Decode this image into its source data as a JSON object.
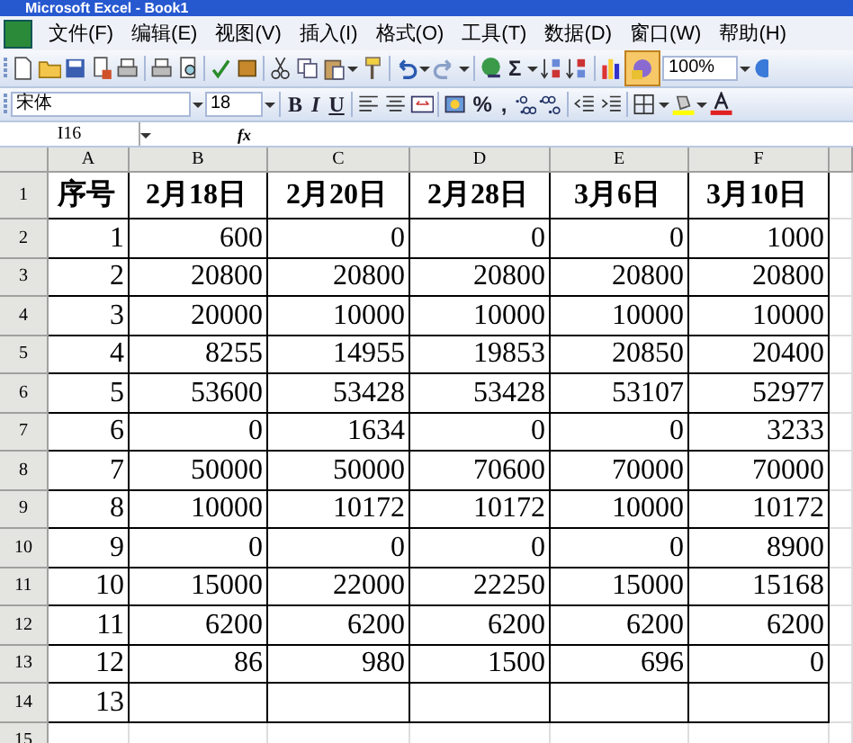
{
  "window": {
    "title": "Microsoft Excel - Book1"
  },
  "menu": [
    "文件(F)",
    "编辑(E)",
    "视图(V)",
    "插入(I)",
    "格式(O)",
    "工具(T)",
    "数据(D)",
    "窗口(W)",
    "帮助(H)"
  ],
  "standard_toolbar": {
    "sum": "Σ",
    "zoom": "100%"
  },
  "formatting_toolbar": {
    "font": "宋体",
    "size": "18",
    "bold": "B",
    "italic": "I",
    "underline": "U",
    "percent": "%",
    "comma": ","
  },
  "formula_bar": {
    "name_box": "I16",
    "fx": "fx"
  },
  "columns": [
    "A",
    "B",
    "C",
    "D",
    "E",
    "F"
  ],
  "rows": [
    {
      "number": "1",
      "cells": [
        "序号",
        "2月18日",
        "2月20日",
        "2月28日",
        "3月6日",
        "3月10日"
      ],
      "kind": "header"
    },
    {
      "number": "2",
      "cells": [
        "1",
        "600",
        "0",
        "0",
        "0",
        "1000"
      ],
      "kind": "data"
    },
    {
      "number": "3",
      "cells": [
        "2",
        "20800",
        "20800",
        "20800",
        "20800",
        "20800"
      ],
      "kind": "data"
    },
    {
      "number": "4",
      "cells": [
        "3",
        "20000",
        "10000",
        "10000",
        "10000",
        "10000"
      ],
      "kind": "data"
    },
    {
      "number": "5",
      "cells": [
        "4",
        "8255",
        "14955",
        "19853",
        "20850",
        "20400"
      ],
      "kind": "data"
    },
    {
      "number": "6",
      "cells": [
        "5",
        "53600",
        "53428",
        "53428",
        "53107",
        "52977"
      ],
      "kind": "data"
    },
    {
      "number": "7",
      "cells": [
        "6",
        "0",
        "1634",
        "0",
        "0",
        "3233"
      ],
      "kind": "data"
    },
    {
      "number": "8",
      "cells": [
        "7",
        "50000",
        "50000",
        "70600",
        "70000",
        "70000"
      ],
      "kind": "data"
    },
    {
      "number": "9",
      "cells": [
        "8",
        "10000",
        "10172",
        "10172",
        "10000",
        "10172"
      ],
      "kind": "data"
    },
    {
      "number": "10",
      "cells": [
        "9",
        "0",
        "0",
        "0",
        "0",
        "8900"
      ],
      "kind": "data"
    },
    {
      "number": "11",
      "cells": [
        "10",
        "15000",
        "22000",
        "22250",
        "15000",
        "15168"
      ],
      "kind": "data"
    },
    {
      "number": "12",
      "cells": [
        "11",
        "6200",
        "6200",
        "6200",
        "6200",
        "6200"
      ],
      "kind": "data"
    },
    {
      "number": "13",
      "cells": [
        "12",
        "86",
        "980",
        "1500",
        "696",
        "0"
      ],
      "kind": "data"
    },
    {
      "number": "14",
      "cells": [
        "13",
        "",
        "",
        "",
        "",
        ""
      ],
      "kind": "data"
    },
    {
      "number": "15",
      "cells": [],
      "kind": "data"
    }
  ]
}
